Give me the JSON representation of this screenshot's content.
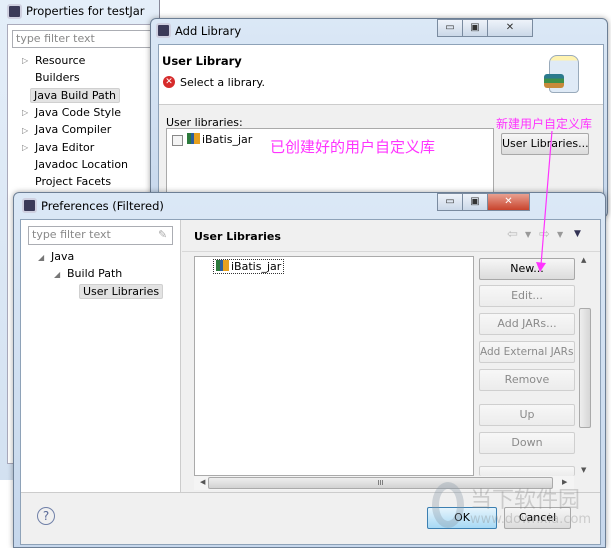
{
  "properties_window": {
    "title": "Properties for testJar",
    "filter_placeholder": "type filter text",
    "tree": [
      {
        "label": "Resource",
        "expandable": true
      },
      {
        "label": "Builders",
        "expandable": false
      },
      {
        "label": "Java Build Path",
        "expandable": false,
        "selected": true
      },
      {
        "label": "Java Code Style",
        "expandable": true
      },
      {
        "label": "Java Compiler",
        "expandable": true
      },
      {
        "label": "Java Editor",
        "expandable": true
      },
      {
        "label": "Javadoc Location",
        "expandable": false
      },
      {
        "label": "Project Facets",
        "expandable": false
      }
    ]
  },
  "add_library_window": {
    "title": "Add Library",
    "header_title": "User Library",
    "error_message": "Select a library.",
    "list_label": "User libraries:",
    "libraries": [
      {
        "label": "iBatis_jar",
        "checked": false
      }
    ],
    "user_libraries_button": "User Libraries..."
  },
  "annotations": {
    "new_library_note": "新建用户自定义库",
    "created_library_note": "已创建好的用户自定义库",
    "color": "#ff33ff"
  },
  "preferences_window": {
    "title": "Preferences (Filtered)",
    "filter_placeholder": "type filter text",
    "tree": [
      {
        "label": "Java"
      },
      {
        "label": "Build Path"
      },
      {
        "label": "User Libraries",
        "selected": true
      }
    ],
    "page_title": "User Libraries",
    "libraries": [
      "iBatis_jar"
    ],
    "buttons": [
      {
        "label": "New...",
        "enabled": true
      },
      {
        "label": "Edit...",
        "enabled": false
      },
      {
        "label": "Add JARs...",
        "enabled": false
      },
      {
        "label": "Add External JARs...",
        "enabled": false
      },
      {
        "label": "Remove",
        "enabled": false
      },
      {
        "label": "Up",
        "enabled": false
      },
      {
        "label": "Down",
        "enabled": false
      }
    ],
    "hscroll_grip": "III",
    "ok": "OK",
    "cancel": "Cancel"
  },
  "watermark": {
    "name": "当下软件园",
    "url": "www.downxia.com"
  }
}
